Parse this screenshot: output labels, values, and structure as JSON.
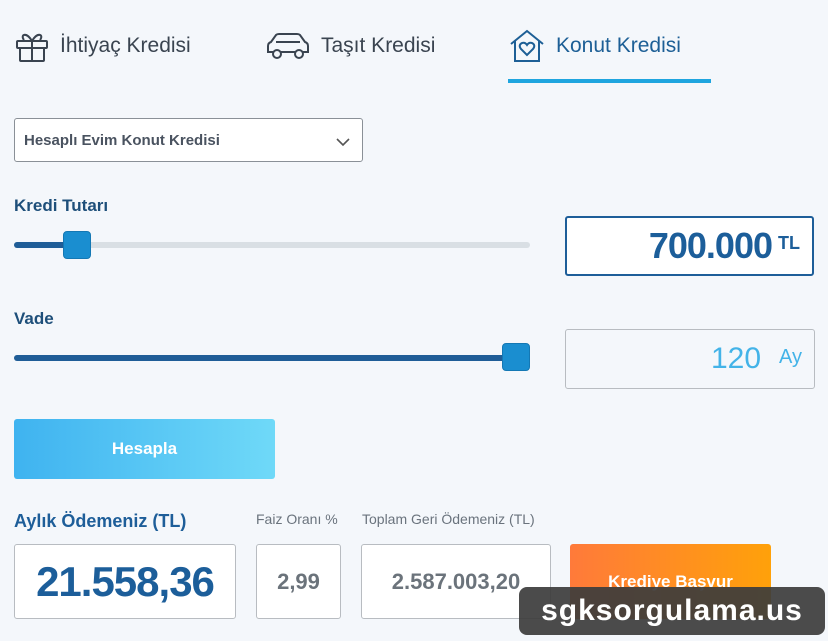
{
  "tabs": [
    {
      "label": "İhtiyaç Kredisi",
      "icon": "gift-icon"
    },
    {
      "label": "Taşıt Kredisi",
      "icon": "car-icon"
    },
    {
      "label": "Konut Kredisi",
      "icon": "house-heart-icon",
      "active": true
    }
  ],
  "loan_type": {
    "selected": "Hesaplı Evim Konut Kredisi"
  },
  "amount": {
    "label": "Kredi Tutarı",
    "value": "700.000",
    "unit": "TL",
    "slider_fraction": 0.1
  },
  "term": {
    "label": "Vade",
    "value": "120",
    "unit": "Ay",
    "slider_fraction": 1.0
  },
  "calculate_button": "Hesapla",
  "results": {
    "monthly_label": "Aylık Ödemeniz (TL)",
    "monthly_value": "21.558,36",
    "rate_label": "Faiz Oranı %",
    "rate_value": "2,99",
    "total_label": "Toplam Geri Ödemeniz (TL)",
    "total_value": "2.587.003,20"
  },
  "apply_button": "Krediye Başvur",
  "watermark": "sgksorgulama.us",
  "colors": {
    "accent": "#1c5e9a",
    "light_accent": "#43b3e8",
    "orange": "#ff8c20"
  }
}
